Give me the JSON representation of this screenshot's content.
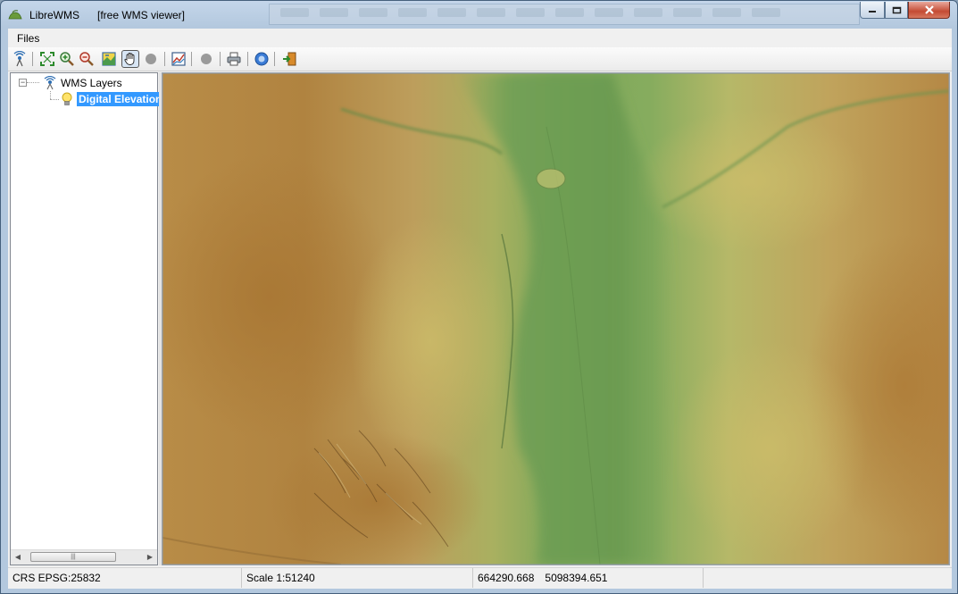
{
  "window": {
    "app_name": "LibreWMS",
    "subtitle": "[free WMS viewer]",
    "controls": {
      "minimize": "minimize",
      "maximize": "maximize",
      "close": "close"
    }
  },
  "menu": {
    "files": "Files"
  },
  "toolbar": {
    "buttons": [
      {
        "icon": "wms-connect-icon"
      },
      {
        "icon": "zoom-extent-icon"
      },
      {
        "icon": "zoom-in-icon"
      },
      {
        "icon": "zoom-out-icon"
      },
      {
        "icon": "layer-extent-icon"
      },
      {
        "icon": "pan-hand-icon",
        "active": true
      },
      {
        "icon": "disabled-tool-icon"
      },
      {
        "icon": "chart-icon"
      },
      {
        "icon": "disabled-tool-icon"
      },
      {
        "icon": "print-icon"
      },
      {
        "icon": "info-icon"
      },
      {
        "icon": "exit-icon"
      }
    ]
  },
  "tree": {
    "root_label": "WMS Layers",
    "layer_label": "Digital Elevation"
  },
  "status": {
    "crs": "CRS EPSG:25832",
    "scale": "Scale 1:51240",
    "x": "664290.668",
    "y": "5098394.651"
  },
  "colors": {
    "selection": "#3399ff",
    "valley_green": "#6f9a52",
    "terrain_brown": "#b0813d",
    "terrain_yellow": "#c2b260"
  }
}
